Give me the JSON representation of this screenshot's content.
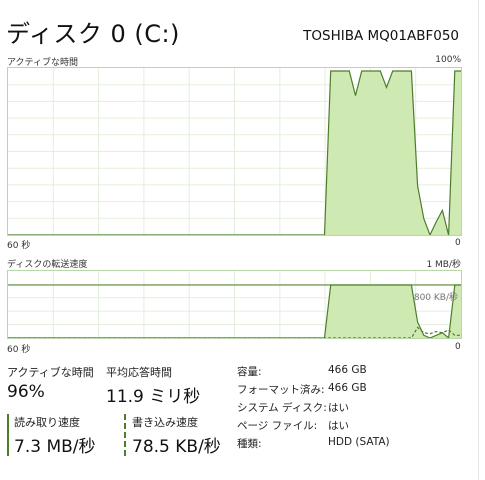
{
  "header": {
    "title": "ディスク 0 (C:)",
    "model": "TOSHIBA MQ01ABF050"
  },
  "active_time_graph": {
    "label": "アクティブな時間",
    "max_label": "100%",
    "time_label": "60 秒",
    "min_label": "0",
    "samples": [
      0,
      0,
      0,
      0,
      0,
      0,
      0,
      0,
      0,
      0,
      0,
      0,
      0,
      0,
      0,
      0,
      0,
      0,
      0,
      0,
      0,
      0,
      0,
      0,
      0,
      0,
      0,
      0,
      0,
      0,
      0,
      0,
      0,
      0,
      0,
      0,
      0,
      0,
      0,
      0,
      0,
      0,
      0,
      0,
      0,
      0,
      0,
      0,
      0,
      0,
      0,
      0,
      100,
      100,
      100,
      100,
      85,
      100,
      100,
      100,
      100,
      90,
      100,
      100,
      100,
      100,
      30,
      10,
      0,
      8,
      15,
      0,
      100,
      100
    ]
  },
  "transfer_graph": {
    "label": "ディスクの転送速度",
    "max_label": "1 MB/秒",
    "time_label": "60 秒",
    "min_label": "0",
    "mid_label": "800 KB/秒",
    "read_samples": [
      0,
      0,
      0,
      0,
      0,
      0,
      0,
      0,
      0,
      0,
      0,
      0,
      0,
      0,
      0,
      0,
      0,
      0,
      0,
      0,
      0,
      0,
      0,
      0,
      0,
      0,
      0,
      0,
      0,
      0,
      0,
      0,
      0,
      0,
      0,
      0,
      0,
      0,
      0,
      0,
      0,
      0,
      0,
      0,
      0,
      0,
      0,
      0,
      0,
      0,
      0,
      0,
      100,
      100,
      100,
      100,
      100,
      100,
      100,
      100,
      100,
      100,
      100,
      100,
      100,
      100,
      30,
      5,
      0,
      5,
      10,
      0,
      100,
      100
    ],
    "write_samples": [
      0,
      0,
      0,
      0,
      0,
      0,
      0,
      0,
      0,
      0,
      0,
      0,
      0,
      0,
      0,
      0,
      0,
      0,
      0,
      0,
      0,
      0,
      0,
      0,
      0,
      0,
      0,
      0,
      0,
      0,
      0,
      0,
      0,
      0,
      0,
      0,
      0,
      0,
      0,
      0,
      0,
      0,
      0,
      0,
      0,
      0,
      0,
      0,
      0,
      0,
      0,
      0,
      0,
      0,
      0,
      0,
      0,
      0,
      0,
      0,
      0,
      0,
      0,
      0,
      0,
      0,
      20,
      10,
      8,
      12,
      10,
      15,
      5,
      5
    ]
  },
  "stats": {
    "active_time_label": "アクティブな時間",
    "active_time_value": "96%",
    "avg_response_label": "平均応答時間",
    "avg_response_value": "11.9 ミリ秒",
    "read_speed_label": "読み取り速度",
    "read_speed_value": "7.3 MB/秒",
    "write_speed_label": "書き込み速度",
    "write_speed_value": "78.5 KB/秒"
  },
  "info": [
    {
      "key": "容量:",
      "value": "466 GB"
    },
    {
      "key": "フォーマット済み:",
      "value": "466 GB"
    },
    {
      "key": "システム ディスク:",
      "value": "はい"
    },
    {
      "key": "ページ ファイル:",
      "value": "はい"
    },
    {
      "key": "種類:",
      "value": "HDD (SATA)"
    }
  ],
  "colors": {
    "graph_border": "#b9d6a6",
    "grid": "#e3efdc",
    "fill": "#cfe9b3",
    "line": "#4d7d2a",
    "accent": "#4d7d2a"
  }
}
